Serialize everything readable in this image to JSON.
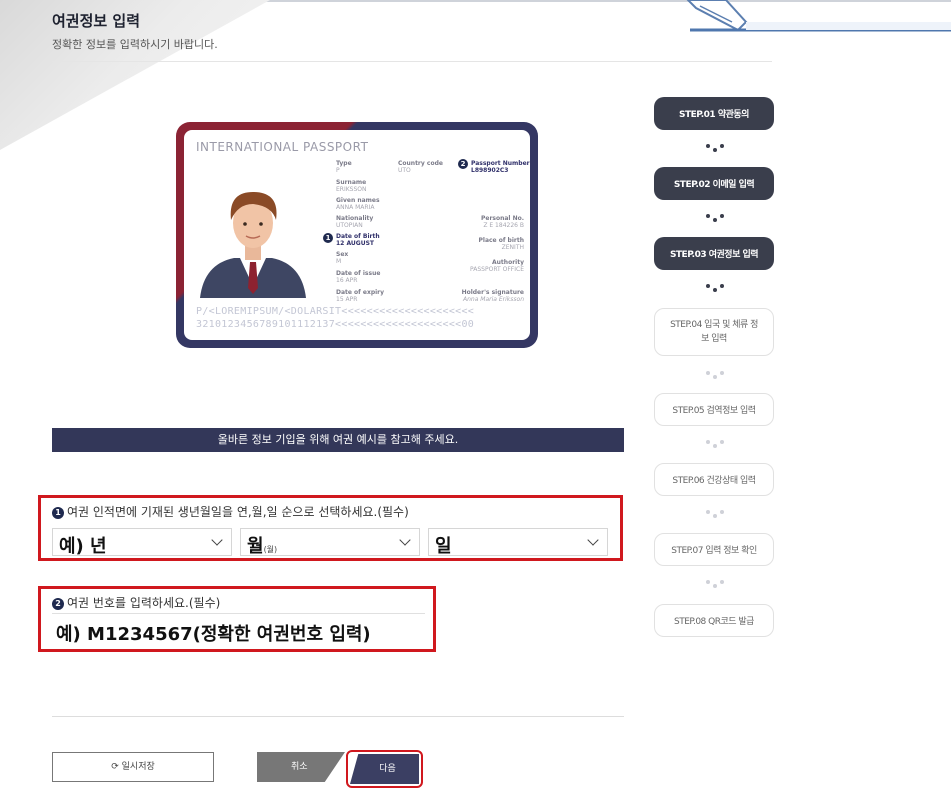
{
  "header": {
    "title": "여권정보 입력",
    "subtitle": "정확한 정보를 입력하시기 바랍니다."
  },
  "passport_example": {
    "heading": "INTERNATIONAL PASSPORT",
    "fields": {
      "type": {
        "label": "Type",
        "value": "P"
      },
      "country_code": {
        "label": "Country code",
        "value": "UTO"
      },
      "passport_number": {
        "label": "Passport Number",
        "value": "L898902C3"
      },
      "surname": {
        "label": "Surname",
        "value": "ERIKSSON"
      },
      "given_names": {
        "label": "Given names",
        "value": "ANNA MARIA"
      },
      "nationality": {
        "label": "Nationality",
        "value": "UTOPIAN"
      },
      "personal_no": {
        "label": "Personal No.",
        "value": "Z E 184226 B"
      },
      "date_of_birth": {
        "label": "Date of Birth",
        "value": "12 AUGUST"
      },
      "place_of_birth": {
        "label": "Place of birth",
        "value": "ZENITH"
      },
      "sex": {
        "label": "Sex",
        "value": "M"
      },
      "authority": {
        "label": "Authority",
        "value": "PASSPORT OFFICE"
      },
      "date_of_issue": {
        "label": "Date of issue",
        "value": "16 APR"
      },
      "date_of_expiry": {
        "label": "Date of expiry",
        "value": "15 APR"
      },
      "holder_signature": {
        "label": "Holder's signature",
        "value": "Anna Maria Eriksson"
      }
    },
    "markers": [
      "1",
      "2"
    ],
    "mrz_line1": "P/<LOREMIPSUM/<DOLARSIT<<<<<<<<<<<<<<<<<<<<<",
    "mrz_line2": "3210123456789101112137<<<<<<<<<<<<<<<<<<<<00",
    "colors": {
      "maroon": "#8b2334",
      "navy": "#343763"
    }
  },
  "notice": "올바른 정보 기입을 위해 여권 예시를 참고해 주세요.",
  "form": {
    "birthdate": {
      "number": "1",
      "label": "여권 인적면에 기재된 생년월일을 연,월,일 순으로 선택하세요.(필수)",
      "year": "예) 년",
      "month": "월",
      "month_small": "(월)",
      "day": "일"
    },
    "passport_no": {
      "number": "2",
      "label": "여권 번호를 입력하세요.(필수)",
      "value": "예) M1234567(정확한 여권번호 입력)"
    }
  },
  "buttons": {
    "temp_save": "일시저장",
    "temp_save_icon": "refresh-icon",
    "cancel": "취소",
    "next": "다음"
  },
  "steps": [
    {
      "label": "STEP.01 약관동의",
      "state": "active"
    },
    {
      "label": "STEP.02 이메일 입력",
      "state": "active"
    },
    {
      "label": "STEP.03 여권정보 입력",
      "state": "active"
    },
    {
      "label": "STEP.04 입국 및 체류 정보 입력",
      "state": "inactive"
    },
    {
      "label": "STEP.05 검역정보 입력",
      "state": "inactive"
    },
    {
      "label": "STEP.06 건강상태 입력",
      "state": "inactive"
    },
    {
      "label": "STEP.07 입력 정보 확인",
      "state": "inactive"
    },
    {
      "label": "STEP.08 QR코드 발급",
      "state": "inactive"
    }
  ],
  "colors": {
    "accent_red": "#d0181e",
    "navy": "#333759",
    "step_active": "#3a3e4c"
  }
}
